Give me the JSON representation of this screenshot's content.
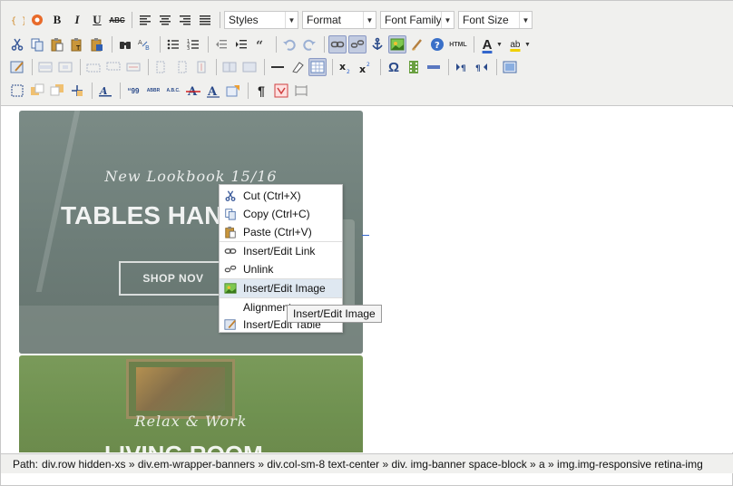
{
  "toolbar": {
    "styles_label": "Styles",
    "format_label": "Format",
    "font_family_label": "Font Family",
    "font_size_label": "Font Size",
    "bold_label": "B",
    "italic_label": "I",
    "underline_label": "U",
    "strike_label": "ABC",
    "html_label": "HTML",
    "text_color_label": "A",
    "ab_label": "ab",
    "omega_label": "Ω",
    "pilcrow_label": "¶",
    "abbr_label": "ABBR",
    "acronym_label": "A.B.C."
  },
  "content": {
    "banner1": {
      "subtitle": "New Lookbook 15/16",
      "title": "TABLES HAN",
      "button": "SHOP NOV"
    },
    "banner2": {
      "subtitle": "Relax & Work",
      "title": "LIVING ROOM"
    }
  },
  "context_menu": {
    "items": [
      {
        "label": "Cut (Ctrl+X)",
        "icon": "scissors-icon"
      },
      {
        "label": "Copy (Ctrl+C)",
        "icon": "copy-icon"
      },
      {
        "label": "Paste (Ctrl+V)",
        "icon": "paste-icon"
      },
      {
        "label": "Insert/Edit Link",
        "icon": "link-icon"
      },
      {
        "label": "Unlink",
        "icon": "unlink-icon"
      },
      {
        "label": "Insert/Edit Image",
        "icon": "image-icon"
      },
      {
        "label": "Alignment",
        "icon": ""
      },
      {
        "label": "Insert/Edit Table",
        "icon": "table-icon"
      }
    ],
    "highlighted": "Insert/Edit Image"
  },
  "tooltip": {
    "text": "Insert/Edit Image"
  },
  "statusbar": {
    "path_label": "Path:",
    "path": "div.row hidden-xs » div.em-wrapper-banners » div.col-sm-8 text-center » div. img-banner space-block » a » img.img-responsive retina-img"
  },
  "colors": {
    "toolbar_bg": "#f0f0ee",
    "menu_highlight": "#dfe8f1",
    "active_button": "#c2cbe0"
  }
}
